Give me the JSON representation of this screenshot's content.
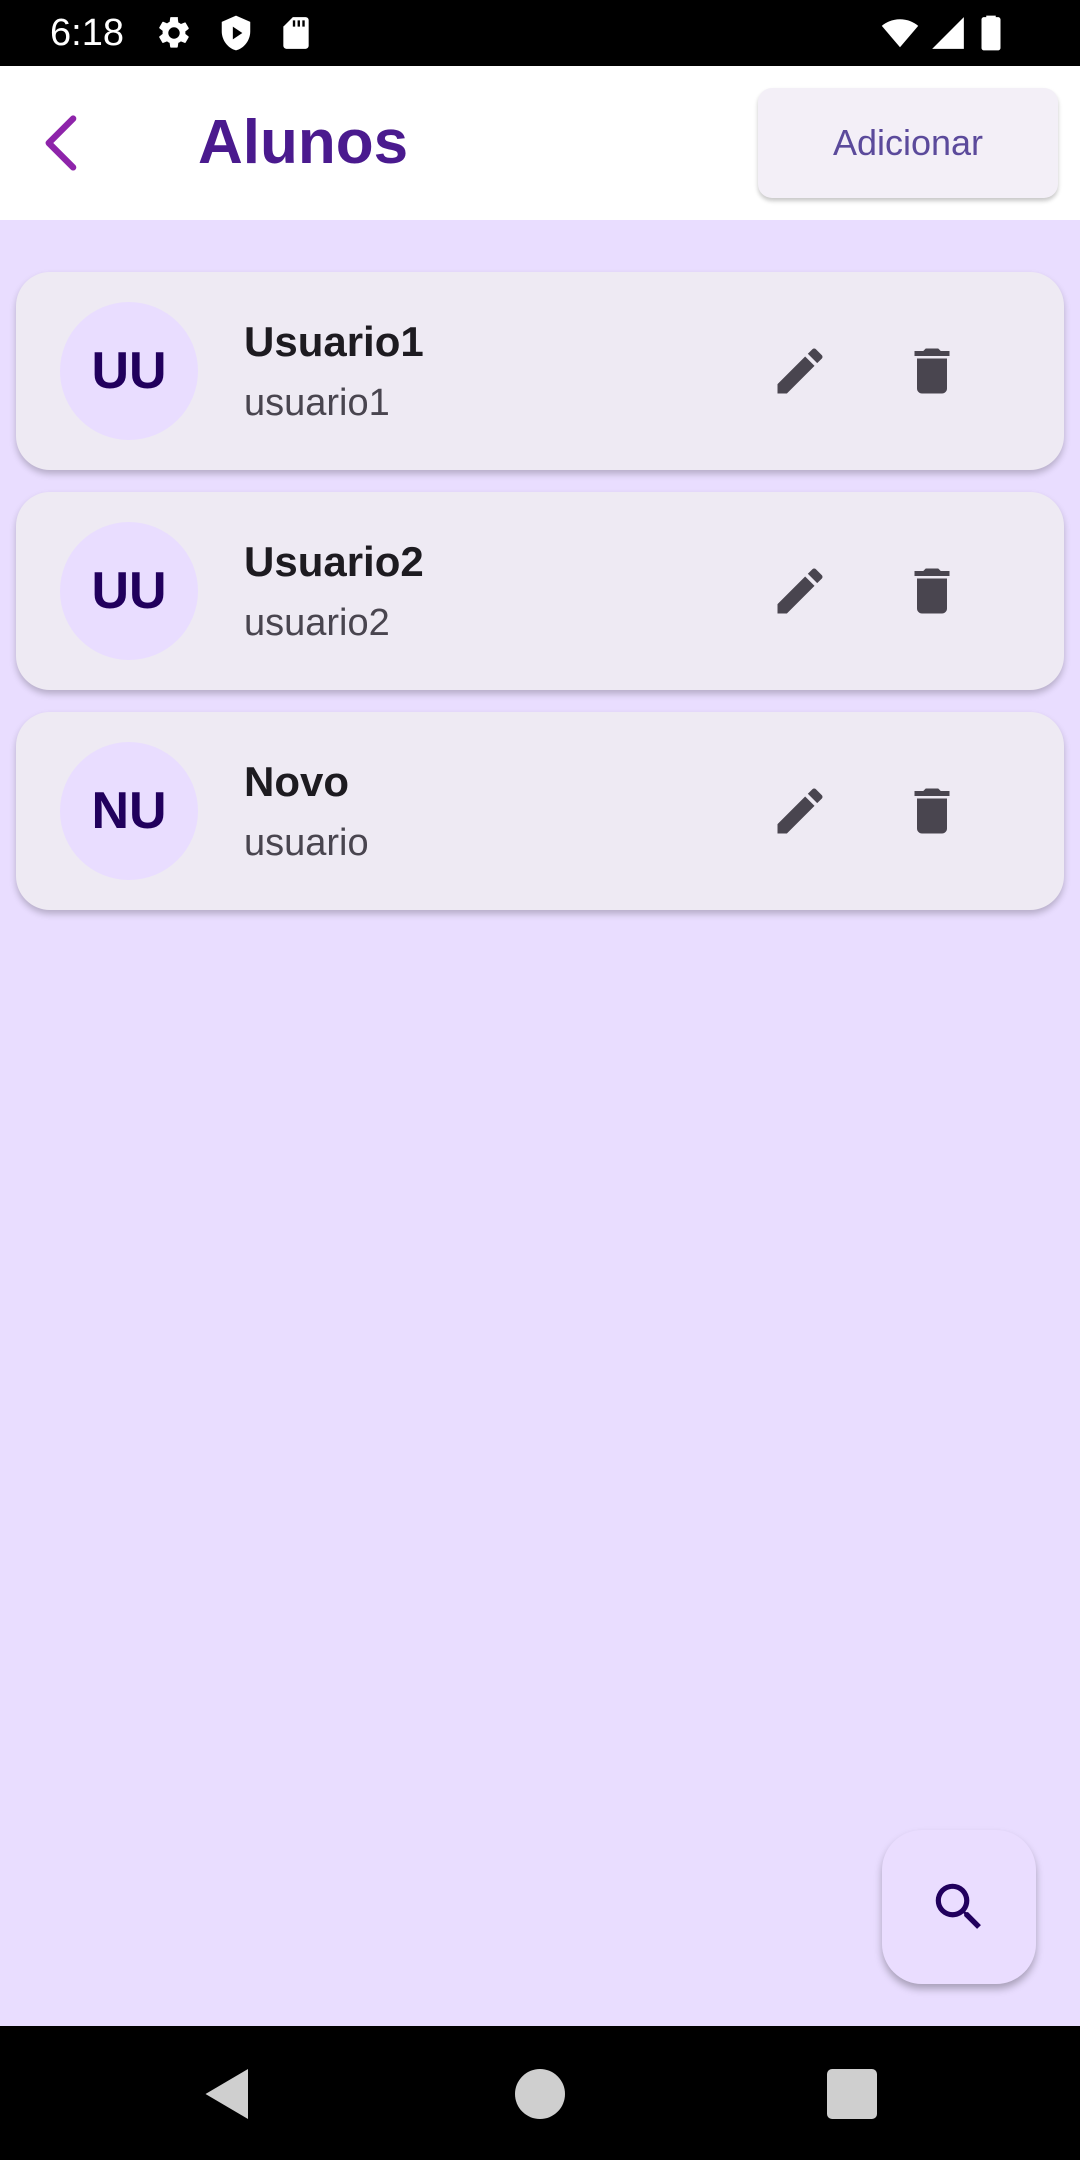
{
  "status_bar": {
    "time": "6:18",
    "left_icons": [
      "gear-icon",
      "play-shield-icon",
      "sd-card-icon"
    ],
    "right_icons": [
      "wifi-icon",
      "cell-signal-icon",
      "battery-icon"
    ]
  },
  "app_bar": {
    "back_icon": "chevron-left-icon",
    "title": "Alunos",
    "add_label": "Adicionar"
  },
  "students": [
    {
      "initials": "UU",
      "name": "Usuario1",
      "username": "usuario1"
    },
    {
      "initials": "UU",
      "name": "Usuario2",
      "username": "usuario2"
    },
    {
      "initials": "NU",
      "name": "Novo",
      "username": "usuario"
    }
  ],
  "fab": {
    "icon": "search-icon"
  },
  "nav_bar": {
    "icons": [
      "back-triangle-icon",
      "home-circle-icon",
      "recents-square-icon"
    ]
  },
  "colors": {
    "background": "#e9ddff",
    "title": "#4a1a8e",
    "back_arrow": "#8e24aa",
    "card": "#eeeaf3",
    "avatar_bg": "#e9ddff",
    "avatar_text": "#21005d",
    "action_icon": "#49454f",
    "button_text": "#5b4a9b"
  }
}
